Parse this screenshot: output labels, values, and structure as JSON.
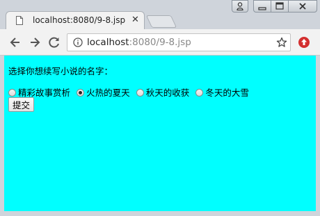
{
  "browser": {
    "tab_title": "localhost:8080/9-8.jsp",
    "url_host": "localhost",
    "url_path": ":8080/9-8.jsp",
    "icons": {
      "back": "back-arrow-icon",
      "forward": "forward-arrow-icon",
      "reload": "reload-icon",
      "info": "info-icon",
      "bookmark": "star-icon",
      "extension": "extension-icon"
    }
  },
  "page": {
    "background_color": "#00ffff",
    "prompt": "选择你想续写小说的名字：",
    "options": [
      {
        "label": "精彩故事赏析",
        "checked": false
      },
      {
        "label": "火热的夏天",
        "checked": true
      },
      {
        "label": "秋天的收获",
        "checked": false
      },
      {
        "label": "冬天的大雪",
        "checked": false
      }
    ],
    "submit_label": "提交"
  }
}
